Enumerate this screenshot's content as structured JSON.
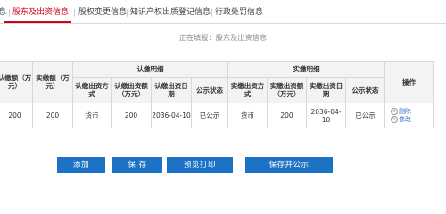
{
  "tabs": [
    {
      "label": "息"
    },
    {
      "label": "股东及出资信息"
    },
    {
      "label": "股权变更信息"
    },
    {
      "label": "知识产权出质登记信息"
    },
    {
      "label": "行政处罚信息"
    }
  ],
  "status_text": "正在填报：股东及出资信息",
  "table": {
    "headers": {
      "subscribed_amount": "认缴额（万元）",
      "paid_amount": "实缴额（万元）",
      "subscribed_detail": "认缴明细",
      "paid_detail": "实缴明细",
      "operation": "操作",
      "sub_method": "认缴出资方式",
      "sub_amount": "认缴出资额（万元）",
      "sub_date": "认缴出资日期",
      "sub_status": "公示状态",
      "paid_method": "实缴出资方式",
      "paid_amount2": "实缴出资额（万元）",
      "paid_date": "实缴出资日期",
      "paid_status": "公示状态"
    },
    "rows": [
      {
        "subscribed": "200",
        "paid": "200",
        "sub_method": "货币",
        "sub_amount": "200",
        "sub_date": "2036-04-10",
        "sub_status": "已公示",
        "paid_method": "货币",
        "paid_amount": "200",
        "paid_date": "2036-04-10",
        "paid_status": "已公示",
        "delete_label": "删除",
        "edit_label": "修改"
      }
    ]
  },
  "buttons": {
    "add": "添加",
    "save": "保 存",
    "preview": "预览打印",
    "save_publish": "保存并公示"
  },
  "colors": {
    "active_tab": "#d0021b",
    "button": "#1c72c4",
    "link": "#3366cc"
  }
}
